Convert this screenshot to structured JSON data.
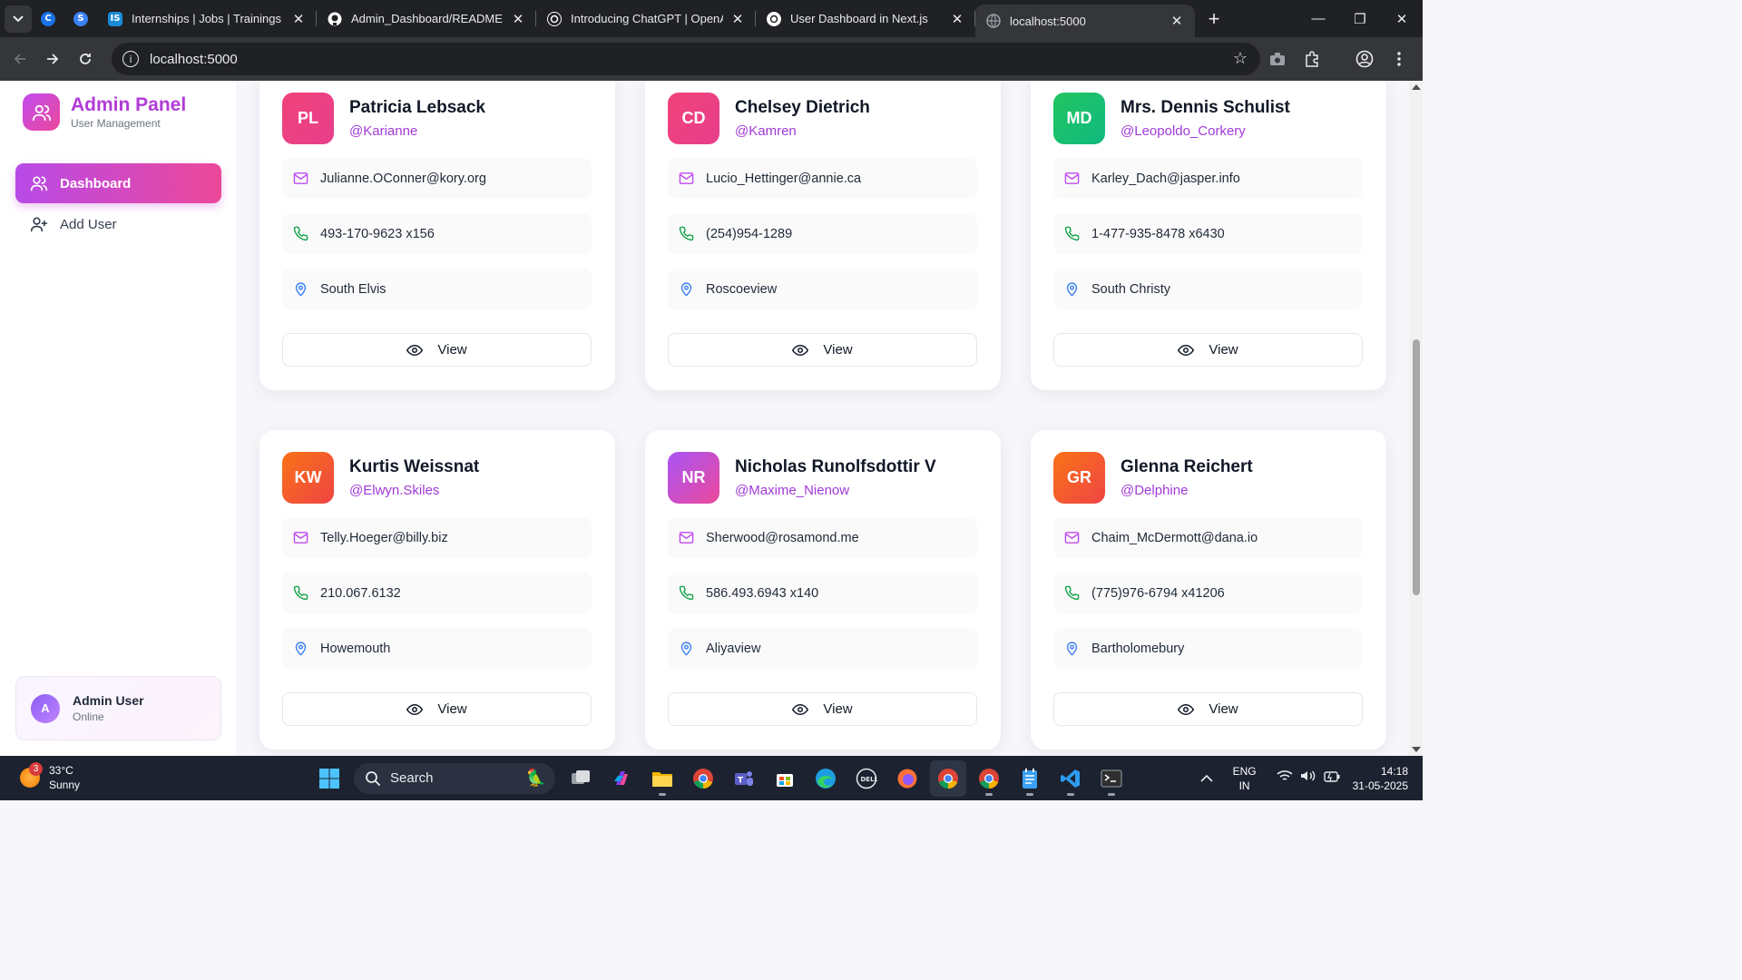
{
  "browser": {
    "tabs": [
      {
        "title": "Internships | Jobs | Trainings & I",
        "favicon": "internshala-icon",
        "color": "#1a8bd6"
      },
      {
        "title": "Admin_Dashboard/README.md",
        "favicon": "github-icon",
        "color": "#ffffff"
      },
      {
        "title": "Introducing ChatGPT | OpenAI",
        "favicon": "openai-icon",
        "color": "#ffffff"
      },
      {
        "title": "User Dashboard in Next.js",
        "favicon": "chatgpt-icon",
        "color": "#ffffff"
      },
      {
        "title": "localhost:5000",
        "favicon": "globe-icon",
        "color": "#9aa0a6"
      }
    ],
    "url": "localhost:5000"
  },
  "sidebar": {
    "brand_title": "Admin Panel",
    "brand_subtitle": "User Management",
    "nav": [
      {
        "label": "Dashboard",
        "icon": "users-icon",
        "active": true
      },
      {
        "label": "Add User",
        "icon": "user-plus-icon",
        "active": false
      }
    ],
    "user": {
      "initial": "A",
      "name": "Admin User",
      "status": "Online"
    }
  },
  "users": [
    {
      "initials": "PL",
      "name": "Patricia Lebsack",
      "handle": "@Karianne",
      "email": "Julianne.OConner@kory.org",
      "phone": "493-170-9623 x156",
      "city": "South Elvis",
      "color_from": "#f0437a",
      "color_to": "#e83e8c"
    },
    {
      "initials": "CD",
      "name": "Chelsey Dietrich",
      "handle": "@Kamren",
      "email": "Lucio_Hettinger@annie.ca",
      "phone": "(254)954-1289",
      "city": "Roscoeview",
      "color_from": "#f0437a",
      "color_to": "#e83e8c"
    },
    {
      "initials": "MD",
      "name": "Mrs. Dennis Schulist",
      "handle": "@Leopoldo_Corkery",
      "email": "Karley_Dach@jasper.info",
      "phone": "1-477-935-8478 x6430",
      "city": "South Christy",
      "color_from": "#22c55e",
      "color_to": "#10b981"
    },
    {
      "initials": "KW",
      "name": "Kurtis Weissnat",
      "handle": "@Elwyn.Skiles",
      "email": "Telly.Hoeger@billy.biz",
      "phone": "210.067.6132",
      "city": "Howemouth",
      "color_from": "#f97316",
      "color_to": "#ef4444"
    },
    {
      "initials": "NR",
      "name": "Nicholas Runolfsdottir V",
      "handle": "@Maxime_Nienow",
      "email": "Sherwood@rosamond.me",
      "phone": "586.493.6943 x140",
      "city": "Aliyaview",
      "color_from": "#a855f7",
      "color_to": "#ec4899"
    },
    {
      "initials": "GR",
      "name": "Glenna Reichert",
      "handle": "@Delphine",
      "email": "Chaim_McDermott@dana.io",
      "phone": "(775)976-6794 x41206",
      "city": "Bartholomebury",
      "color_from": "#f97316",
      "color_to": "#ef4444"
    }
  ],
  "view_label": "View",
  "taskbar": {
    "weather_badge": "3",
    "temperature": "33°C",
    "condition": "Sunny",
    "search_placeholder": "Search",
    "lang_top": "ENG",
    "lang_bottom": "IN",
    "time": "14:18",
    "date": "31-05-2025"
  }
}
